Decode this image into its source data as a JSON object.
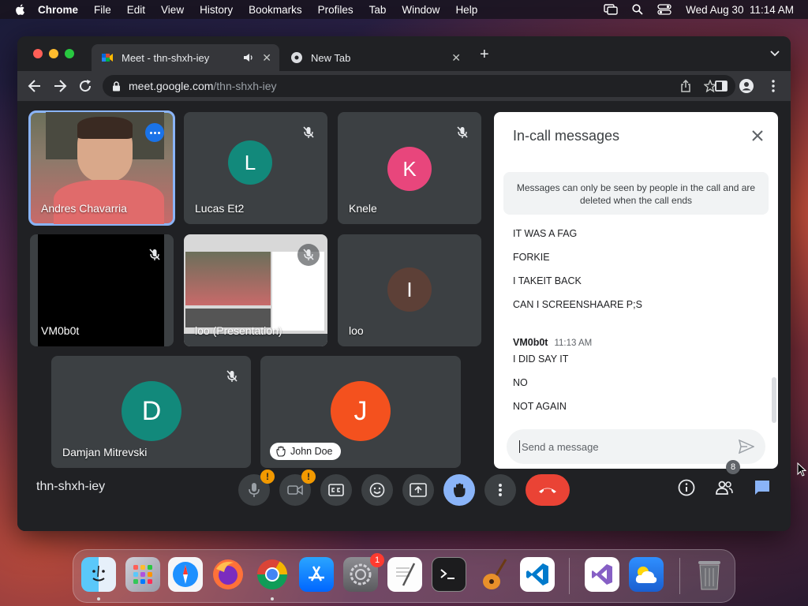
{
  "menubar": {
    "app": "Chrome",
    "items": [
      "File",
      "Edit",
      "View",
      "History",
      "Bookmarks",
      "Profiles",
      "Tab",
      "Window",
      "Help"
    ],
    "datetime": "Wed Aug 30  11:14 AM"
  },
  "browser": {
    "tabs": [
      {
        "title": "Meet - thn-shxh-iey",
        "icon": "google-meet-icon",
        "active": true
      },
      {
        "title": "New Tab",
        "icon": "chrome-icon",
        "active": false
      }
    ],
    "url_host": "meet.google.com",
    "url_path": "/thn-shxh-iey"
  },
  "meet": {
    "code": "thn-shxh-iey",
    "participants_count": "8",
    "tiles": [
      {
        "name": "Andres Chavarria",
        "kind": "video",
        "speaking": true
      },
      {
        "name": "Lucas Et2",
        "initial": "L",
        "color": "#12897b",
        "muted": true
      },
      {
        "name": "Knele",
        "initial": "K",
        "color": "#e8467c",
        "muted": true
      },
      {
        "name": "VM0b0t",
        "kind": "video-black",
        "muted": true
      },
      {
        "name": "loo (Presentation)",
        "kind": "presentation",
        "muted": true
      },
      {
        "name": "loo",
        "initial": "I",
        "color": "#5d4037",
        "muted": false
      },
      {
        "name": "Damjan Mitrevski",
        "initial": "D",
        "color": "#12897b",
        "muted": true
      },
      {
        "name": "John Doe",
        "initial": "J",
        "color": "#f4511e",
        "muted": false,
        "hand_raised": true
      }
    ]
  },
  "chat": {
    "title": "In-call messages",
    "notice": "Messages can only be seen by people in the call and are deleted when the call ends",
    "messages_a": [
      "IT WAS A FAG",
      "FORKIE",
      "I TAKEIT BACK",
      "CAN I SCREENSHAARE P;S"
    ],
    "sender": "VM0b0t",
    "sender_time": "11:13 AM",
    "messages_b": [
      "I DID SAY IT",
      "NO",
      "NOT AGAIN"
    ],
    "input_placeholder": "Send a message"
  },
  "dock": {
    "apps": [
      "finder-icon",
      "launchpad-icon",
      "safari-icon",
      "firefox-icon",
      "chrome-icon",
      "app-store-icon",
      "system-settings-icon",
      "textedit-icon",
      "terminal-icon",
      "garageband-icon",
      "vscode-icon",
      "visual-studio-icon",
      "weather-icon",
      "trash-icon"
    ],
    "settings_badge": "1"
  },
  "colors": {
    "meet_bg": "#202124",
    "tile_bg": "#3c4043",
    "accent_blue": "#8ab4f8",
    "end_call_red": "#ea4335",
    "warning_orange": "#f29900"
  }
}
